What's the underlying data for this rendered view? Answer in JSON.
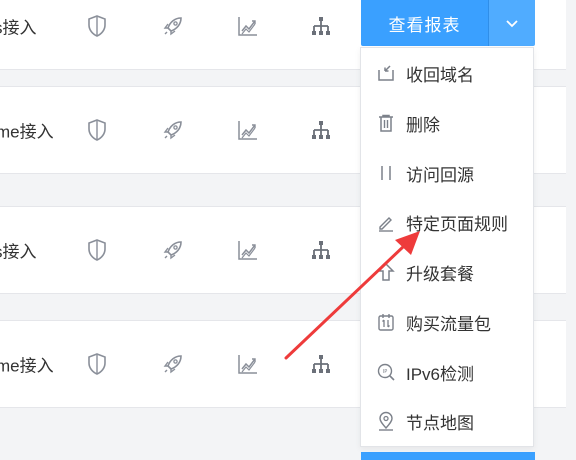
{
  "rows": [
    {
      "label": "s接入"
    },
    {
      "label": "me接入"
    },
    {
      "label": "s接入"
    },
    {
      "label": "me接入"
    }
  ],
  "report_button": {
    "label": "查看报表"
  },
  "menu": [
    {
      "label": "收回域名",
      "icon": "reclaim-icon"
    },
    {
      "label": "删除",
      "icon": "trash-icon"
    },
    {
      "label": "访问回源",
      "icon": "origin-icon"
    },
    {
      "label": "特定页面规则",
      "icon": "pencil-icon"
    },
    {
      "label": "升级套餐",
      "icon": "upgrade-arrow-icon"
    },
    {
      "label": "购买流量包",
      "icon": "traffic-package-icon"
    },
    {
      "label": "IPv6检测",
      "icon": "ipv6-search-icon"
    },
    {
      "label": "节点地图",
      "icon": "location-pin-icon"
    }
  ],
  "colors": {
    "accent": "#3aa0ff",
    "annotation_arrow": "#ee3b3b",
    "icon_gray": "#8a8f99"
  }
}
